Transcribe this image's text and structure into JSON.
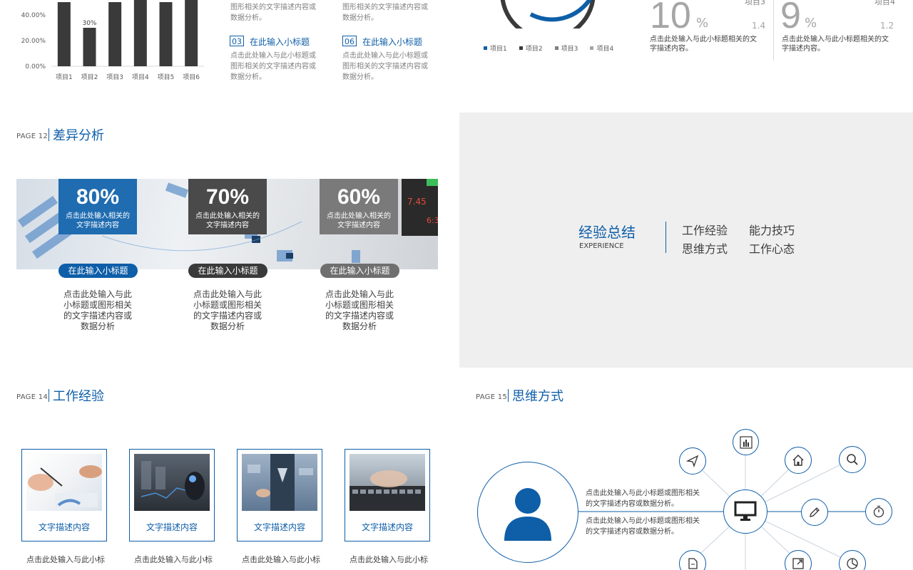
{
  "colors": {
    "primary": "#0e5ea8",
    "dark": "#3a3a3a",
    "gray": "#7f7f7f",
    "panel": "#efefef"
  },
  "slide10": {
    "chart_data": {
      "type": "bar",
      "categories": [
        "项目1",
        "项目2",
        "项目3",
        "项目4",
        "项目5",
        "项目6"
      ],
      "values": [
        50,
        30,
        50,
        53,
        50,
        53
      ],
      "ytick_labels": [
        "0.00%",
        "20.00%",
        "40.00%"
      ],
      "ylim": [
        0,
        53
      ],
      "data_labels": [
        {
          "index": 1,
          "text": "30%"
        }
      ]
    },
    "top_text_1": "图形相关的文字描述内容或",
    "top_text_1b": "数据分析。",
    "top_text_2": "图形相关的文字描述内容或",
    "top_text_2b": "数据分析。",
    "items": [
      {
        "num": "03",
        "title": "在此输入小标题",
        "lines": [
          "点击此处输入与此小标题或",
          "图形相关的文字描述内容或",
          "数据分析。"
        ]
      },
      {
        "num": "06",
        "title": "在此输入小标题",
        "lines": [
          "点击此处输入与此小标题或",
          "图形相关的文字描述内容或",
          "数据分析。"
        ]
      }
    ]
  },
  "slide11": {
    "legend": [
      {
        "label": "项目1",
        "color": "#0e5ea8"
      },
      {
        "label": "项目2",
        "color": "#3a3a3a"
      },
      {
        "label": "项目3",
        "color": "#7f7f7f"
      },
      {
        "label": "项目4",
        "color": "#a6a6a6"
      }
    ],
    "stats": [
      {
        "name": "项目3",
        "big": "10",
        "pct": "%",
        "small": "1.4",
        "lines": [
          "点击此处输入与此小标题相关的文",
          "字描述内容。"
        ]
      },
      {
        "name": "项目4",
        "big": "9",
        "pct": "%",
        "small": "1.2",
        "lines": [
          "点击此处输入与此小标题相关的文",
          "字描述内容。"
        ]
      }
    ]
  },
  "slide12": {
    "page": "PAGE 12",
    "title": "差异分析",
    "boxes": [
      {
        "pct": "80%",
        "lines": [
          "点击此处输入相关的",
          "文字描述内容"
        ],
        "pill": "在此输入小标题",
        "color": "#1f6cb0",
        "pill_color": "#0e5ea8",
        "desc": [
          "点击此处输入与此",
          "小标题或图形相关",
          "的文字描述内容或",
          "数据分析"
        ]
      },
      {
        "pct": "70%",
        "lines": [
          "点击此处输入相关的",
          "文字描述内容"
        ],
        "pill": "在此输入小标题",
        "color": "#4a4a4a",
        "pill_color": "#3a3a3a",
        "desc": [
          "点击此处输入与此",
          "小标题或图形相关",
          "的文字描述内容或",
          "数据分析"
        ]
      },
      {
        "pct": "60%",
        "lines": [
          "点击此处输入相关的",
          "文字描述内容"
        ],
        "pill": "在此输入小标题",
        "color": "#7a7a7a",
        "pill_color": "#6f6f6f",
        "desc": [
          "点击此处输入与此",
          "小标题或图形相关",
          "的文字描述内容或",
          "数据分析"
        ]
      }
    ]
  },
  "slide13": {
    "title": "经验总结",
    "subtitle": "EXPERIENCE",
    "items": [
      "工作经验",
      "能力技巧",
      "思维方式",
      "工作心态"
    ]
  },
  "slide14": {
    "page": "PAGE 14",
    "title": "工作经验",
    "cards": [
      {
        "label": "文字描述内容",
        "desc": "点击此处输入与此小标"
      },
      {
        "label": "文字描述内容",
        "desc": "点击此处输入与此小标"
      },
      {
        "label": "文字描述内容",
        "desc": "点击此处输入与此小标"
      },
      {
        "label": "文字描述内容",
        "desc": "点击此处输入与此小标"
      }
    ]
  },
  "slide15": {
    "page": "PAGE 15",
    "title": "思维方式",
    "text1": [
      "点击此处输入与此小标题或图形相关",
      "的文字描述内容或数据分析。"
    ],
    "text2": [
      "点击此处输入与此小标题或图形相关",
      "的文字描述内容或数据分析。"
    ],
    "icons": [
      "chart-icon",
      "send-icon",
      "home-icon",
      "search-icon",
      "pencil-icon",
      "timer-icon",
      "monitor-icon",
      "user-icon",
      "document-icon",
      "expand-icon",
      "pie-icon"
    ]
  }
}
